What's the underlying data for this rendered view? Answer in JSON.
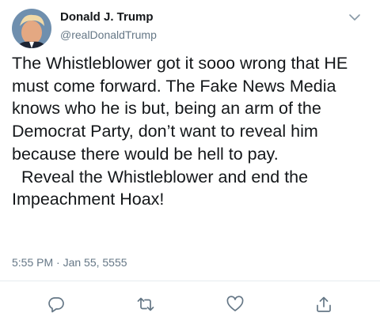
{
  "tweet": {
    "author_name": "Donald J. Trump",
    "author_handle": "@realDonaldTrump",
    "text": "The Whistleblower got it sooo wrong that HE must come forward. The Fake News Media knows who he is but, being an arm of the Democrat Party, don’t want to reveal him because there would be hell to pay.\n  Reveal the Whistleblower and end the Impeachment Hoax!",
    "timestamp": "5:55 PM · Jan 55, 5555"
  },
  "icons": {
    "menu": "chevron-down-icon",
    "reply": "reply-icon",
    "retweet": "retweet-icon",
    "like": "heart-icon",
    "share": "share-icon"
  },
  "colors": {
    "text": "#14171a",
    "secondary": "#657786",
    "icon": "#657786",
    "divider": "#e6ecf0"
  }
}
